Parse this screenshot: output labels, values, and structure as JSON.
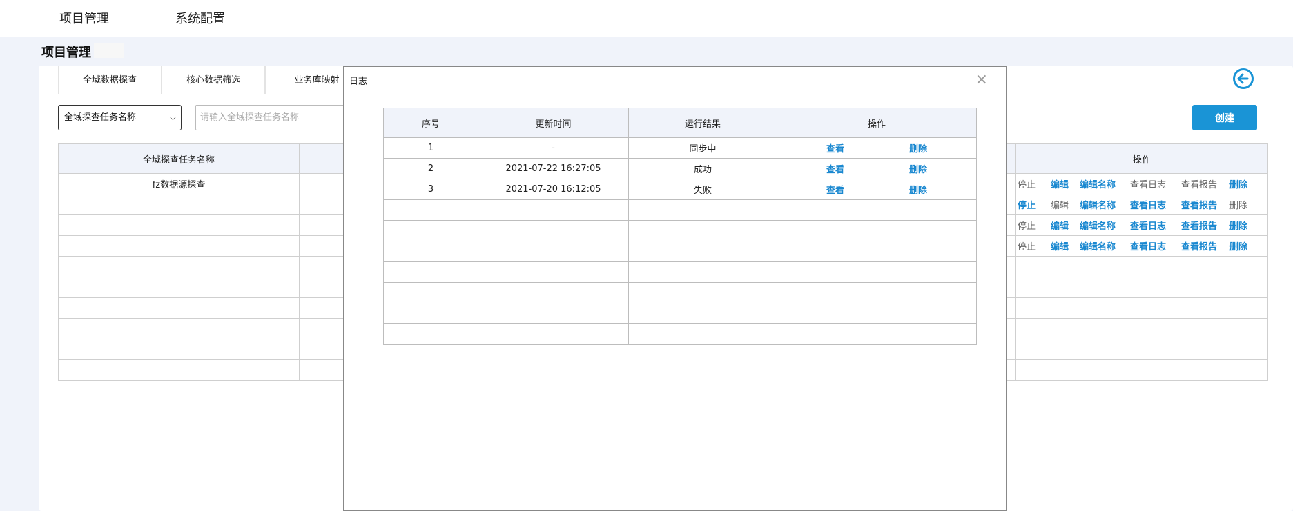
{
  "topnav": {
    "items": [
      {
        "label": "项目管理"
      },
      {
        "label": "系统配置"
      }
    ]
  },
  "page": {
    "title": "项目管理"
  },
  "tabs": [
    {
      "label": "全域数据探查"
    },
    {
      "label": "核心数据筛选"
    },
    {
      "label": "业务库映射"
    }
  ],
  "filter": {
    "select_value": "全域探查任务名称",
    "search_placeholder": "请输入全域探查任务名称",
    "create_label": "创建"
  },
  "main_table": {
    "headers": {
      "name": "全域探查任务名称",
      "ops": "操作"
    },
    "rows": [
      {
        "name": "fz数据源探查",
        "ops": [
          "停止",
          "编辑",
          "编辑名称",
          "查看日志",
          "查看报告",
          "删除"
        ],
        "ops_enabled": [
          false,
          true,
          true,
          false,
          false,
          true
        ]
      },
      {
        "name": "",
        "ops": [
          "停止",
          "编辑",
          "编辑名称",
          "查看日志",
          "查看报告",
          "删除"
        ],
        "ops_enabled": [
          true,
          false,
          true,
          true,
          true,
          false
        ]
      },
      {
        "name": "",
        "ops": [
          "停止",
          "编辑",
          "编辑名称",
          "查看日志",
          "查看报告",
          "删除"
        ],
        "ops_enabled": [
          false,
          true,
          true,
          true,
          true,
          true
        ]
      },
      {
        "name": "",
        "ops": [
          "停止",
          "编辑",
          "编辑名称",
          "查看日志",
          "查看报告",
          "删除"
        ],
        "ops_enabled": [
          false,
          true,
          true,
          true,
          true,
          true
        ]
      },
      {
        "name": "",
        "ops": []
      },
      {
        "name": "",
        "ops": []
      },
      {
        "name": "",
        "ops": []
      },
      {
        "name": "",
        "ops": []
      },
      {
        "name": "",
        "ops": []
      },
      {
        "name": "",
        "ops": []
      }
    ]
  },
  "modal": {
    "title": "日志",
    "close_glyph": "×",
    "headers": [
      "序号",
      "更新时间",
      "运行结果",
      "操作"
    ],
    "rows": [
      {
        "index": "1",
        "time": "-",
        "result": "同步中",
        "view": "查看",
        "delete": "删除"
      },
      {
        "index": "2",
        "time": "2021-07-22 16:27:05",
        "result": "成功",
        "view": "查看",
        "delete": "删除"
      },
      {
        "index": "3",
        "time": "2021-07-20 16:12:05",
        "result": "失败",
        "view": "查看",
        "delete": "删除"
      }
    ],
    "empty_rows": 7
  },
  "colors": {
    "accent": "#1a94d6",
    "link": "#1a88d0",
    "header_bg": "#f0f3fa"
  },
  "icons": {
    "back": "arrow-left-circle-icon",
    "close": "close-icon",
    "dropdown": "chevron-down-icon"
  }
}
